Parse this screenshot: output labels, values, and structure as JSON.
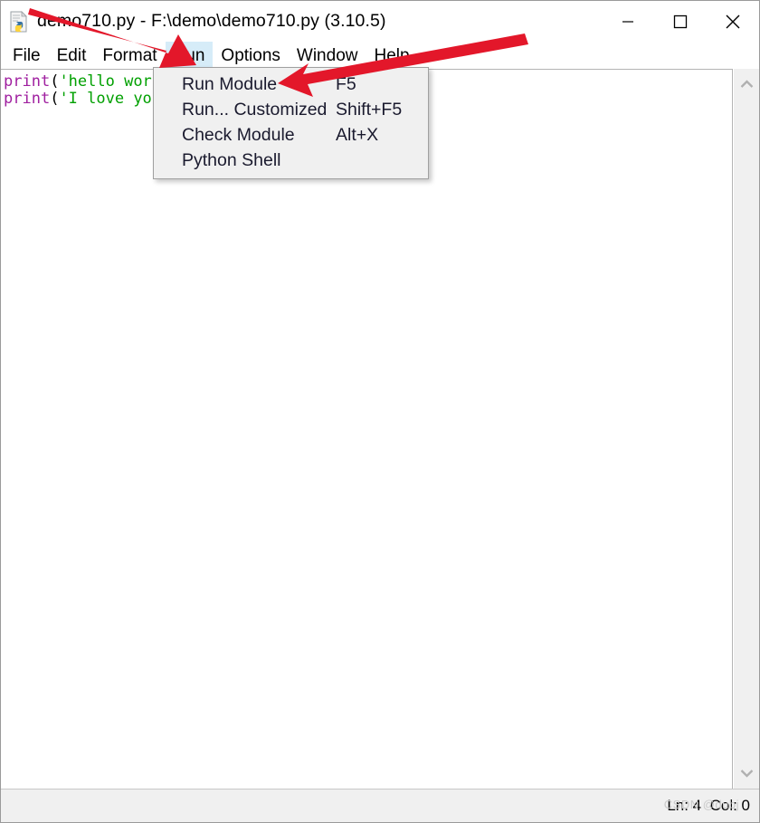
{
  "window": {
    "title": "demo710.py - F:\\demo\\demo710.py (3.10.5)",
    "icon": "python-file-icon",
    "caption": {
      "minimize_label": "Minimize",
      "maximize_label": "Maximize",
      "close_label": "Close"
    }
  },
  "menubar": {
    "items": [
      {
        "label": "File",
        "active": false
      },
      {
        "label": "Edit",
        "active": false
      },
      {
        "label": "Format",
        "active": false
      },
      {
        "label": "Run",
        "active": true
      },
      {
        "label": "Options",
        "active": false
      },
      {
        "label": "Window",
        "active": false
      },
      {
        "label": "Help",
        "active": false
      }
    ],
    "active_highlight_color": "#d6ecf8"
  },
  "run_menu": {
    "items": [
      {
        "label": "Run Module",
        "accel": "F5"
      },
      {
        "label": "Run... Customized",
        "accel": "Shift+F5"
      },
      {
        "label": "Check Module",
        "accel": "Alt+X"
      },
      {
        "label": "Python Shell",
        "accel": ""
      }
    ]
  },
  "editor": {
    "lines": [
      {
        "fn": "print",
        "open": "(",
        "string": "'hello wor"
      },
      {
        "fn": "print",
        "open": "(",
        "string": "'I love yo"
      }
    ],
    "colors": {
      "function": "#a020a0",
      "string": "#00a000",
      "punctuation": "#000000",
      "background": "#ffffff"
    }
  },
  "scrollbar": {
    "up_arrow": "chevron-up-icon",
    "down_arrow": "chevron-down-icon"
  },
  "statusbar": {
    "position_text": "Ln: 4  Col: 0",
    "watermark": "CSDN @dubj"
  },
  "annotations": {
    "arrow_1": {
      "name": "arrow-to-run-menu",
      "color": "#e3172a"
    },
    "arrow_2": {
      "name": "arrow-to-run-module-item",
      "color": "#e3172a"
    }
  }
}
